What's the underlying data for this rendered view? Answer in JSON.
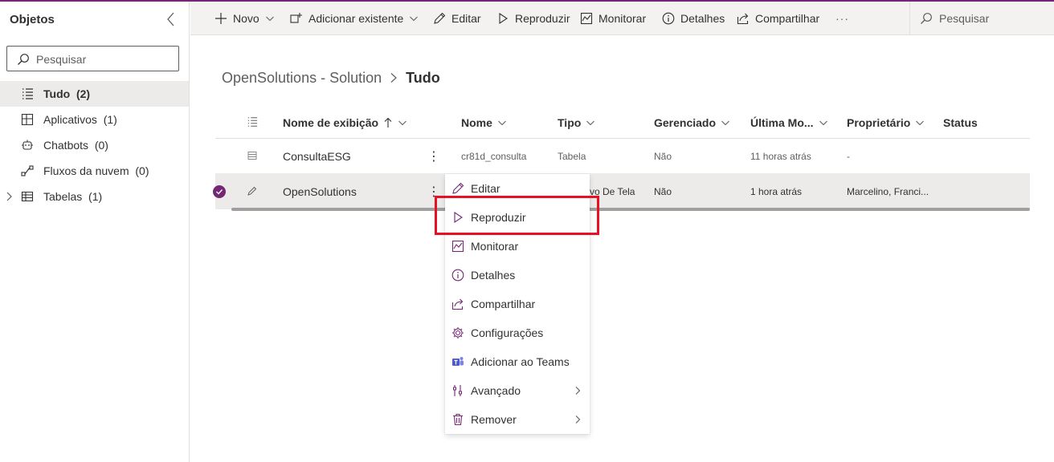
{
  "accent_color": "#742774",
  "highlight_color": "#e81123",
  "sidebar": {
    "title": "Objetos",
    "collapse_icon": "chevron-left-icon",
    "search_placeholder": "Pesquisar",
    "items": [
      {
        "label": "Tudo",
        "count": "(2)",
        "icon": "list-icon",
        "selected": true
      },
      {
        "label": "Aplicativos",
        "count": "(1)",
        "icon": "apps-icon"
      },
      {
        "label": "Chatbots",
        "count": "(0)",
        "icon": "bot-icon"
      },
      {
        "label": "Fluxos da nuvem",
        "count": "(0)",
        "icon": "flow-icon"
      },
      {
        "label": "Tabelas",
        "count": "(1)",
        "icon": "table-icon",
        "expand_icon": "chevron-right-icon"
      }
    ]
  },
  "commandbar": {
    "new_label": "Novo",
    "add_existing_label": "Adicionar existente",
    "edit_label": "Editar",
    "play_label": "Reproduzir",
    "monitor_label": "Monitorar",
    "details_label": "Detalhes",
    "share_label": "Compartilhar",
    "more_label": "···",
    "search_label": "Pesquisar"
  },
  "breadcrumb": {
    "parent": "OpenSolutions - Solution",
    "current": "Tudo"
  },
  "table": {
    "columns": {
      "display_name": "Nome de exibição",
      "name": "Nome",
      "type": "Tipo",
      "managed": "Gerenciado",
      "modified": "Última Mo...",
      "owner": "Proprietário",
      "status": "Status"
    },
    "rows": [
      {
        "display_name": "ConsultaESG",
        "name": "cr81d_consulta",
        "type": "Tabela",
        "managed": "Não",
        "modified": "11 horas atrás",
        "owner": "-",
        "icon": "table-icon",
        "selected": false
      },
      {
        "display_name": "OpenSolutions",
        "name": "",
        "type": "vo De Tela",
        "managed": "Não",
        "modified": "1 hora atrás",
        "owner": "Marcelino, Franci...",
        "icon": "pencil-icon",
        "selected": true
      }
    ],
    "more_glyph": "⋮"
  },
  "context_menu": {
    "items": [
      {
        "label": "Editar",
        "icon": "edit-icon"
      },
      {
        "label": "Reproduzir",
        "icon": "play-icon",
        "highlighted": true
      },
      {
        "label": "Monitorar",
        "icon": "monitor-icon"
      },
      {
        "label": "Detalhes",
        "icon": "info-icon"
      },
      {
        "label": "Compartilhar",
        "icon": "share-icon"
      },
      {
        "label": "Configurações",
        "icon": "settings-icon"
      },
      {
        "label": "Adicionar ao Teams",
        "icon": "teams-icon"
      },
      {
        "label": "Avançado",
        "icon": "advanced-icon",
        "submenu": true
      },
      {
        "label": "Remover",
        "icon": "delete-icon",
        "submenu": true
      }
    ]
  }
}
